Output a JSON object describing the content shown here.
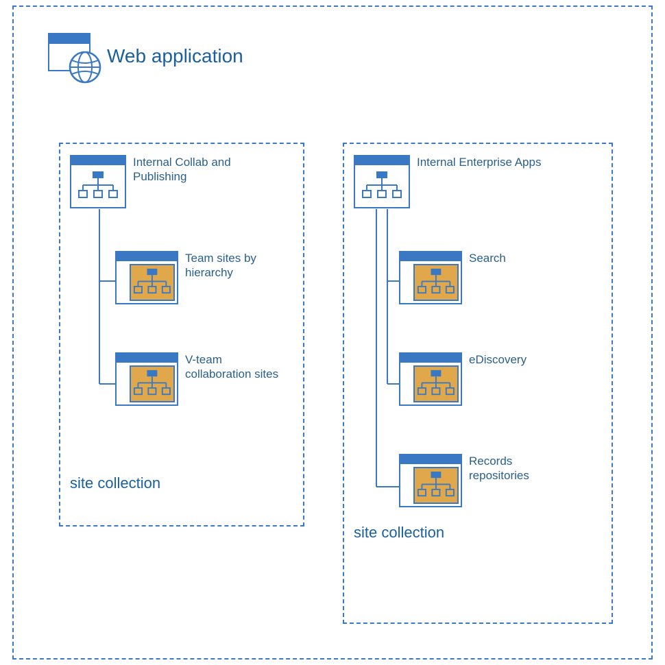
{
  "webapp": {
    "title": "Web application"
  },
  "collections": [
    {
      "label": "site collection",
      "root": {
        "label": "Internal Collab and Publishing"
      },
      "children": [
        {
          "label": "Team sites by hierarchy"
        },
        {
          "label": "V-team collaboration sites"
        }
      ]
    },
    {
      "label": "site collection",
      "root": {
        "label": "Internal Enterprise Apps"
      },
      "children": [
        {
          "label": "Search"
        },
        {
          "label": "eDiscovery"
        },
        {
          "label": "Records repositories"
        }
      ]
    }
  ],
  "colors": {
    "stroke": "#3a78c3",
    "fill_blue": "#3a78c3",
    "fill_gold": "#e0a84a",
    "text": "#1a5f9e"
  }
}
